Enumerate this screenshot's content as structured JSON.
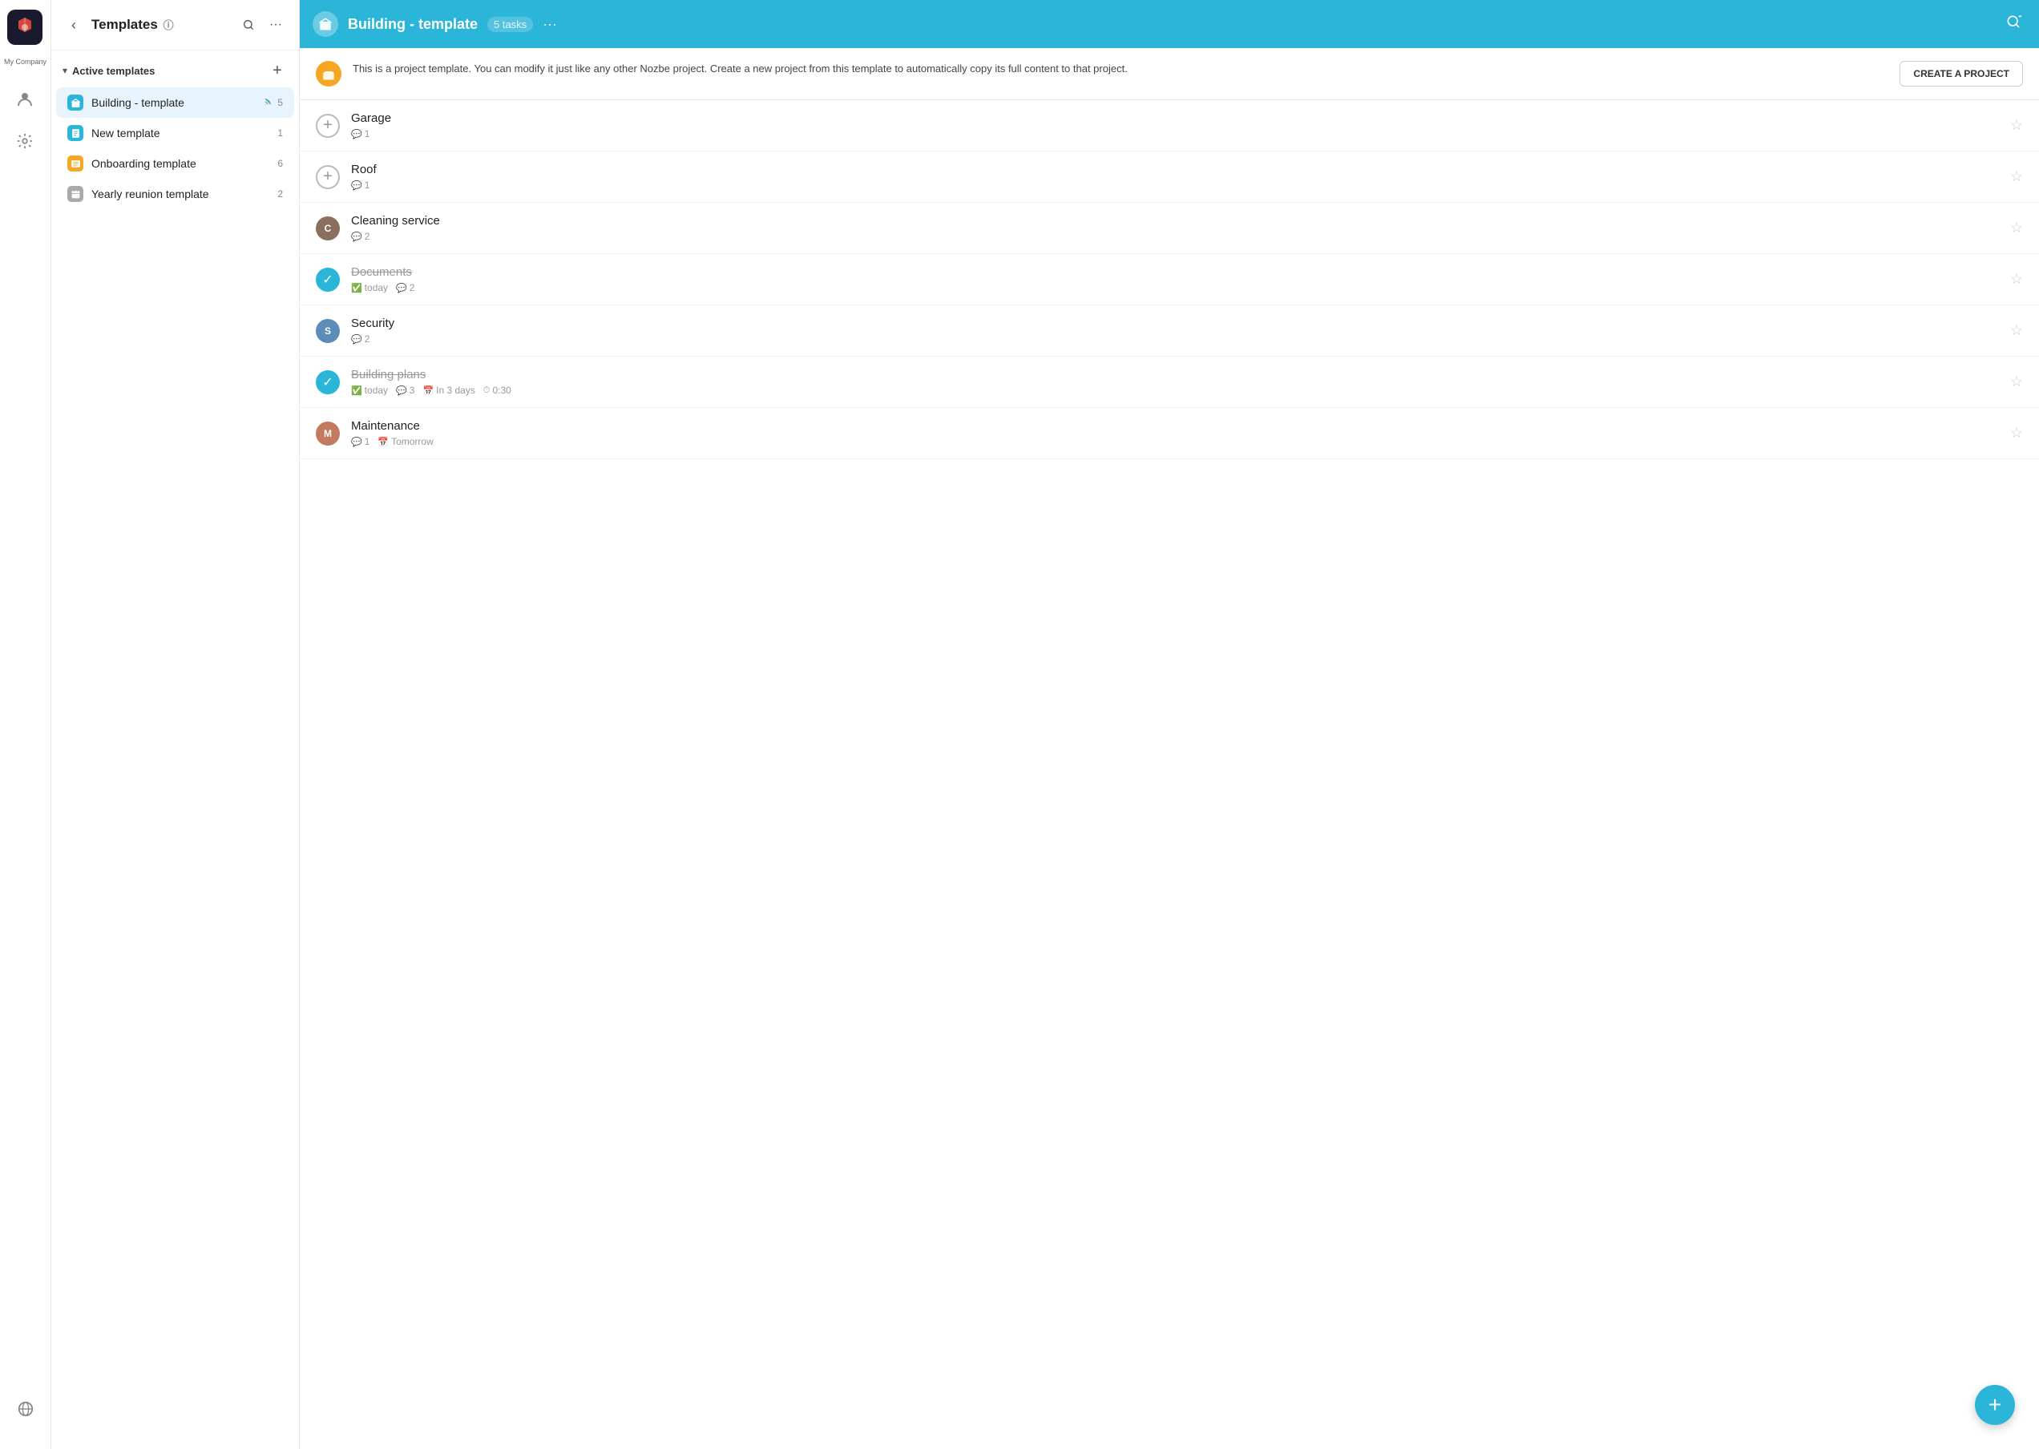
{
  "iconBar": {
    "companyName": "My Company",
    "myNozbeLabel": "My Nozbe",
    "manageLabel": "Manage",
    "globalLabel": "Globe"
  },
  "sidebar": {
    "backButton": "‹",
    "title": "Templates",
    "infoIcon": "ⓘ",
    "searchIcon": "🔍",
    "moreIcon": "···",
    "sectionTitle": "Active templates",
    "addIcon": "+",
    "templates": [
      {
        "name": "Building - template",
        "color": "#2bb5d8",
        "iconChar": "🏢",
        "active": true,
        "hasRss": true,
        "count": 5
      },
      {
        "name": "New template",
        "color": "#2bb5d8",
        "iconChar": "📁",
        "active": false,
        "hasRss": false,
        "count": 1
      },
      {
        "name": "Onboarding template",
        "color": "#f5a623",
        "iconChar": "📦",
        "active": false,
        "hasRss": false,
        "count": 6
      },
      {
        "name": "Yearly reunion template",
        "color": "#888",
        "iconChar": "📋",
        "active": false,
        "hasRss": false,
        "count": 2
      }
    ]
  },
  "header": {
    "title": "Building - template",
    "tasksBadge": "5 tasks",
    "moreIcon": "···"
  },
  "infoBanner": {
    "text": "This is a project template. You can modify it just like any other Nozbe project. Create a new project from this template to automatically copy its full content to that project.",
    "createButtonLabel": "CREATE A PROJECT"
  },
  "tasks": [
    {
      "id": 1,
      "name": "Garage",
      "completed": false,
      "hasAvatar": false,
      "addBtn": true,
      "avatarColor": "",
      "avatarInitial": "",
      "meta": [
        {
          "icon": "💬",
          "value": "1"
        }
      ]
    },
    {
      "id": 2,
      "name": "Roof",
      "completed": false,
      "hasAvatar": false,
      "addBtn": true,
      "avatarColor": "",
      "avatarInitial": "",
      "meta": [
        {
          "icon": "💬",
          "value": "1"
        }
      ]
    },
    {
      "id": 3,
      "name": "Cleaning service",
      "completed": false,
      "hasAvatar": true,
      "addBtn": false,
      "avatarColor": "#8b6f5e",
      "avatarInitial": "C",
      "meta": [
        {
          "icon": "💬",
          "value": "2"
        }
      ]
    },
    {
      "id": 4,
      "name": "Documents",
      "completed": true,
      "hasAvatar": false,
      "addBtn": false,
      "avatarColor": "",
      "avatarInitial": "",
      "meta": [
        {
          "icon": "✅",
          "value": "today"
        },
        {
          "icon": "💬",
          "value": "2"
        }
      ]
    },
    {
      "id": 5,
      "name": "Security",
      "completed": false,
      "hasAvatar": true,
      "addBtn": false,
      "avatarColor": "#5b8db8",
      "avatarInitial": "S",
      "meta": [
        {
          "icon": "💬",
          "value": "2"
        }
      ]
    },
    {
      "id": 6,
      "name": "Building plans",
      "completed": true,
      "hasAvatar": false,
      "addBtn": false,
      "avatarColor": "",
      "avatarInitial": "",
      "meta": [
        {
          "icon": "✅",
          "value": "today"
        },
        {
          "icon": "💬",
          "value": "3"
        },
        {
          "icon": "📅",
          "value": "In 3 days"
        },
        {
          "icon": "⏱",
          "value": "0:30"
        }
      ]
    },
    {
      "id": 7,
      "name": "Maintenance",
      "completed": false,
      "hasAvatar": true,
      "addBtn": false,
      "avatarColor": "#c47a5e",
      "avatarInitial": "M",
      "meta": [
        {
          "icon": "💬",
          "value": "1"
        },
        {
          "icon": "📅",
          "value": "Tomorrow"
        }
      ]
    }
  ],
  "fab": {
    "icon": "+"
  }
}
